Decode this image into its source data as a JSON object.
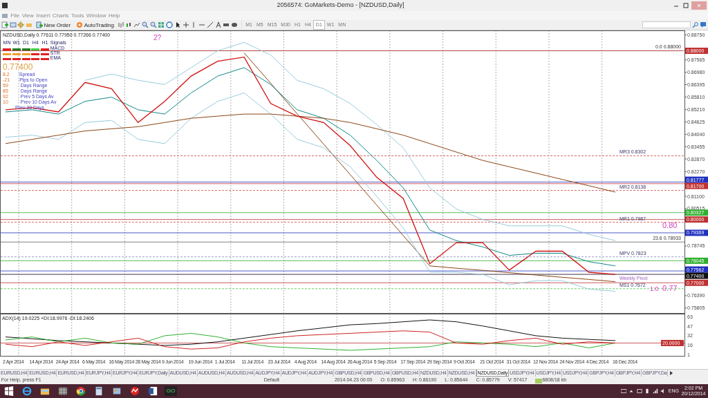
{
  "window": {
    "title": "2056574: GoMarkets-Demo - [NZDUSD,Daily]"
  },
  "menu": [
    "File",
    "View",
    "Insert",
    "Charts",
    "Tools",
    "Window",
    "Help"
  ],
  "toolbar": {
    "buttons": [
      "New Order",
      "AutoTrading"
    ],
    "timeframes": [
      {
        "label": "M1",
        "selected": false
      },
      {
        "label": "M5",
        "selected": false
      },
      {
        "label": "M15",
        "selected": false
      },
      {
        "label": "M30",
        "selected": false
      },
      {
        "label": "H1",
        "selected": false
      },
      {
        "label": "H4",
        "selected": false
      },
      {
        "label": "D1",
        "selected": true
      },
      {
        "label": "W1",
        "selected": false
      },
      {
        "label": "MN",
        "selected": false
      }
    ]
  },
  "chart": {
    "header": "NZDUSD,Daily  0.77611 0.77950 0.77266 0.77400",
    "signals": {
      "columns": [
        "MN",
        "W1",
        "D1",
        "H4",
        "H1"
      ],
      "title": "Signals",
      "rows": [
        {
          "name": "MACD",
          "cells": [
            {
              "color": "#e02020"
            },
            {
              "color": "#208020"
            },
            {
              "color": "#208020"
            },
            {
              "color": "#40d040"
            },
            {
              "color": "#e02020"
            }
          ]
        },
        {
          "name": "STR",
          "cells": [
            {
              "color": "#f0a030"
            },
            {
              "color": "#f0a030"
            },
            {
              "color": "#f0a030"
            },
            {
              "color": "#e02020"
            },
            {
              "color": "#e02020"
            }
          ]
        },
        {
          "name": "EMA",
          "cells": [
            {
              "color": "#e02020"
            },
            {
              "color": "#e02020"
            },
            {
              "color": "#e02020"
            },
            {
              "color": "#e02020"
            },
            {
              "color": "#e02020"
            }
          ]
        }
      ]
    },
    "price": "0.77400",
    "stats": [
      {
        "value": "8.2",
        "label": "Spread"
      },
      {
        "value": "-21",
        "label": "Pips to Open"
      },
      {
        "value": "59",
        "label": "Days Range"
      },
      {
        "value": "85",
        "label": "Days Range"
      },
      {
        "value": "92",
        "label": "Prev 5 Days Av"
      },
      {
        "value": "10",
        "label": "Prev 10 Days Av"
      },
      {
        "label": "Prev 30 Days"
      }
    ],
    "chart_data": {
      "type": "line",
      "series": [
        {
          "color": "#d01010",
          "values": [
            0.852,
            0.853,
            0.851,
            0.865,
            0.862,
            0.846,
            0.856,
            0.868,
            0.875,
            0.877,
            0.855,
            0.849,
            0.846,
            0.835,
            0.82,
            0.81,
            0.779,
            0.789,
            0.789,
            0.776,
            0.785,
            0.785,
            0.775,
            0.774
          ]
        },
        {
          "color": "#8b4513",
          "values": [
            0.836,
            0.838,
            0.84,
            0.842,
            0.843,
            0.844,
            0.846,
            0.848,
            0.849,
            0.85,
            0.85,
            0.849,
            0.848,
            0.846,
            0.843,
            0.84,
            0.836,
            0.832,
            0.828,
            0.825,
            0.822,
            0.819,
            0.816,
            0.813
          ]
        },
        {
          "color": "#118888",
          "values": [
            0.851,
            0.852,
            0.85,
            0.856,
            0.858,
            0.852,
            0.85,
            0.86,
            0.868,
            0.872,
            0.864,
            0.852,
            0.848,
            0.84,
            0.828,
            0.815,
            0.795,
            0.79,
            0.787,
            0.783,
            0.784,
            0.784,
            0.78,
            0.778
          ]
        },
        {
          "color": "#99ccdd",
          "values": [
            null,
            null,
            null,
            0.866,
            0.869,
            0.866,
            0.864,
            0.872,
            0.88,
            0.884,
            0.878,
            0.866,
            0.862,
            0.855,
            0.845,
            0.834,
            0.815,
            0.805,
            0.8,
            0.797,
            0.797,
            0.797,
            0.793,
            0.79
          ]
        },
        {
          "color": "#99ccdd",
          "values": [
            0.839,
            0.84,
            0.838,
            0.846,
            0.847,
            0.838,
            0.836,
            0.848,
            0.856,
            0.86,
            0.85,
            0.838,
            0.834,
            0.825,
            0.811,
            0.796,
            0.775,
            0.775,
            0.774,
            0.769,
            0.771,
            0.771,
            0.767,
            0.766
          ]
        },
        {
          "color": "#8b4513",
          "values": [
            null,
            null,
            null,
            null,
            null,
            null,
            null,
            null,
            null,
            0.879,
            0.8646,
            0.8501,
            0.8357,
            0.8213,
            0.8068,
            0.7924,
            0.778,
            null,
            null,
            null,
            null,
            null,
            null,
            null
          ]
        },
        {
          "color": "#8b4513",
          "values": [
            null,
            null,
            null,
            null,
            null,
            null,
            null,
            null,
            null,
            null,
            null,
            null,
            null,
            null,
            null,
            null,
            0.778,
            0.7769,
            0.7759,
            0.7748,
            0.7737,
            0.7726,
            0.7716,
            0.7705
          ]
        }
      ],
      "ylim": [
        0.756,
        0.889
      ],
      "yticks": [
        {
          "value": 0.8875,
          "label": "0.88750"
        },
        {
          "value": 0.87565,
          "label": "0.87565"
        },
        {
          "value": 0.8698,
          "label": "0.86980"
        },
        {
          "value": 0.86395,
          "label": "0.86395"
        },
        {
          "value": 0.8581,
          "label": "0.85810"
        },
        {
          "value": 0.8521,
          "label": "0.85210"
        },
        {
          "value": 0.84625,
          "label": "0.84625"
        },
        {
          "value": 0.8404,
          "label": "0.84040"
        },
        {
          "value": 0.83455,
          "label": "0.83455"
        },
        {
          "value": 0.8287,
          "label": "0.82870"
        },
        {
          "value": 0.8227,
          "label": "0.82270"
        },
        {
          "value": 0.811,
          "label": "0.81100"
        },
        {
          "value": 0.80515,
          "label": "0.80515"
        },
        {
          "value": 0.78745,
          "label": "0.78745"
        },
        {
          "value": 0.7639,
          "label": "0.76390"
        },
        {
          "value": 0.75805,
          "label": "0.75805"
        }
      ],
      "ref_lines": [
        {
          "axis": "y",
          "value": 0.88,
          "label": "0.0 0.88000",
          "color": "#808080"
        },
        {
          "axis": "y",
          "value": 0.88,
          "label": "0.88000",
          "color": "#c03030"
        },
        {
          "axis": "y",
          "value": 0.8302,
          "label": "MR3  0.8302",
          "color": "#d04040"
        },
        {
          "axis": "y",
          "value": 0.817,
          "label": "0.81700",
          "color": "#c03030"
        },
        {
          "axis": "y",
          "value": 0.81777,
          "label": "0.81777",
          "color": "#2030c0"
        },
        {
          "axis": "y",
          "value": 0.8138,
          "label": "MR2  0.8138",
          "color": "#d04040"
        },
        {
          "axis": "y",
          "value": 0.80327,
          "label": "0.80327",
          "color": "#30b030"
        },
        {
          "axis": "y",
          "value": 0.8,
          "label": "0.80000",
          "color": "#c03030"
        },
        {
          "axis": "y",
          "value": 0.7987,
          "label": "MR1  0.7987",
          "color": "#d04040"
        },
        {
          "axis": "y",
          "value": 0.79369,
          "label": "0.79369",
          "color": "#2030c0"
        },
        {
          "axis": "y",
          "value": 0.78933,
          "label": "23.6  0.78933",
          "color": "#606060"
        },
        {
          "axis": "y",
          "value": 0.7823,
          "label": "MPV  0.7823",
          "color": "#8080c0"
        },
        {
          "axis": "y",
          "value": 0.78045,
          "label": "0.78045",
          "color": "#30b030"
        },
        {
          "axis": "y",
          "value": 0.77562,
          "label": "0.77562",
          "color": "#2030c0"
        },
        {
          "axis": "y",
          "value": 0.774,
          "label": "0.77400",
          "color": "#101010"
        },
        {
          "axis": "y",
          "value": 0.774,
          "label": "Weekly Pivot",
          "color": "#a060c0"
        },
        {
          "axis": "y",
          "value": 0.77,
          "label": "0.77000",
          "color": "#c03030"
        },
        {
          "axis": "y",
          "value": 0.7672,
          "label": "MS1  0.7672",
          "color": "#40c040"
        }
      ],
      "annotations": [
        "2?",
        "0.80",
        "0.77",
        "1:0"
      ]
    }
  },
  "indicator": {
    "header": "ADX(14) 19.0225 +DI:18.9976 -DI:18.2406",
    "chart_data": {
      "type": "line",
      "categories": [
        "2 Apr 2014",
        "14 Apr 2014",
        "24 Apr 2014",
        "6 May 2014",
        "16 May 2014",
        "28 May 2014",
        "9 Jun 2014",
        "19 Jun 2014",
        "1 Jul 2014",
        "11 Jul 2014",
        "23 Jul 2014",
        "4 Aug 2014",
        "14 Aug 2014",
        "26 Aug 2014",
        "5 Sep 2014",
        "17 Sep 2014",
        "29 Sep 2014",
        "9 Oct 2014",
        "21 Oct 2014",
        "31 Oct 2014",
        "12 Nov 2014",
        "24 Nov 2014",
        "4 Dec 2014",
        "16 Dec 2014"
      ],
      "series": [
        {
          "color": "#101010",
          "values": [
            30,
            27,
            24,
            22,
            20,
            18,
            16,
            18,
            22,
            28,
            34,
            40,
            45,
            50,
            52,
            55,
            58,
            55,
            48,
            40,
            32,
            28,
            26,
            24
          ]
        },
        {
          "color": "#30b030",
          "values": [
            25,
            30,
            22,
            28,
            20,
            18,
            32,
            36,
            30,
            20,
            14,
            12,
            10,
            8,
            10,
            12,
            14,
            22,
            20,
            18,
            14,
            20,
            12,
            20
          ]
        },
        {
          "color": "#d02020",
          "values": [
            18,
            14,
            22,
            16,
            22,
            28,
            14,
            10,
            12,
            22,
            28,
            32,
            34,
            36,
            38,
            40,
            38,
            20,
            18,
            24,
            28,
            18,
            22,
            20
          ]
        }
      ],
      "ylim": [
        0,
        66
      ],
      "yticks": [
        1,
        16,
        32,
        47,
        63
      ],
      "ref_lines": [
        {
          "axis": "y",
          "value": 20,
          "label": "20.0000",
          "color": "#c03030"
        }
      ]
    }
  },
  "chart_tabs": [
    {
      "label": "EURUSD,H4",
      "selected": false
    },
    {
      "label": "EURUSD,H4",
      "selected": false
    },
    {
      "label": "EURUSD,H4",
      "selected": false
    },
    {
      "label": "EURJPY,H4",
      "selected": false
    },
    {
      "label": "EURJPY,H4",
      "selected": false
    },
    {
      "label": "EURJPY,Daily",
      "selected": false
    },
    {
      "label": "AUDUSD,H4",
      "selected": false
    },
    {
      "label": "AUDUSD,H4",
      "selected": false
    },
    {
      "label": "AUDUSD,H4",
      "selected": false
    },
    {
      "label": "AUDJPY,H4",
      "selected": false
    },
    {
      "label": "AUDJPY,H4",
      "selected": false
    },
    {
      "label": "AUDJPY,H4",
      "selected": false
    },
    {
      "label": "GBPUSD,H4",
      "selected": false
    },
    {
      "label": "GBPUSD,H4",
      "selected": false
    },
    {
      "label": "GBPUSD,H4",
      "selected": false
    },
    {
      "label": "NZDUSD,H4",
      "selected": false
    },
    {
      "label": "NZDUSD,H4",
      "selected": false
    },
    {
      "label": "NZDUSD,Daily",
      "selected": true
    },
    {
      "label": "USDJPY,H4",
      "selected": false
    },
    {
      "label": "USDJPY,H4",
      "selected": false
    },
    {
      "label": "USDJPY,H4",
      "selected": false
    },
    {
      "label": "GBPJPY,H4",
      "selected": false
    },
    {
      "label": "GBPJPY,H4",
      "selected": false
    },
    {
      "label": "GBPJPY,Da",
      "selected": false
    }
  ],
  "status_bar": [
    "For Help, press F1",
    "Default",
    "2014.04.23 00:00",
    "O: 0.85963",
    "H: 0.86190",
    "L: 0.85644",
    "C: 0.85779",
    "V: 57417",
    "6808/18 kb"
  ],
  "taskbar": {
    "app_label": "GO",
    "language": "ENG",
    "time": "2:02 PM",
    "date": "20/12/2014"
  }
}
